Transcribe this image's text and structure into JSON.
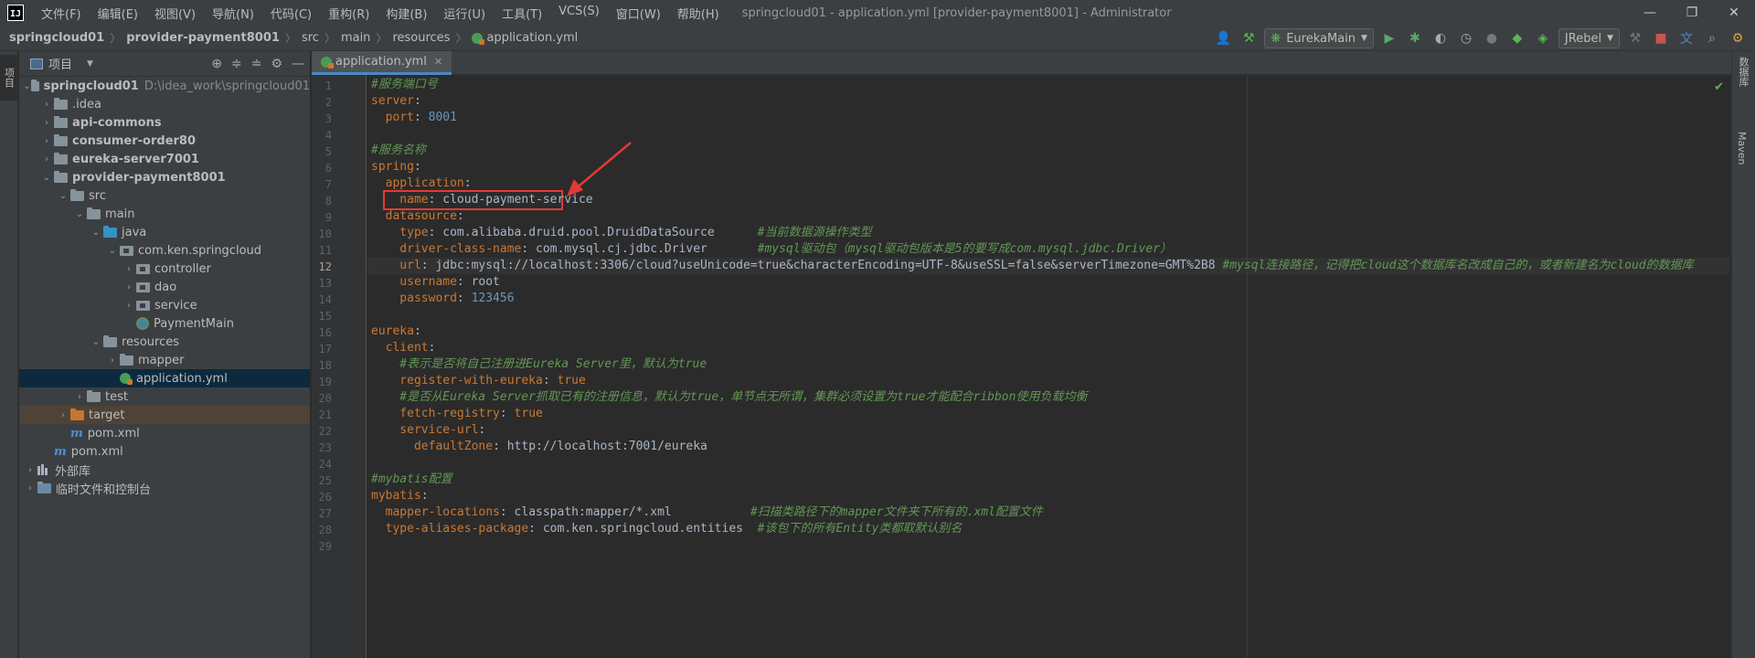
{
  "titlebar": {
    "logo": "IJ",
    "menu": [
      "文件(F)",
      "编辑(E)",
      "视图(V)",
      "导航(N)",
      "代码(C)",
      "重构(R)",
      "构建(B)",
      "运行(U)",
      "工具(T)",
      "VCS(S)",
      "窗口(W)",
      "帮助(H)"
    ],
    "title": "springcloud01 - application.yml [provider-payment8001] - Administrator",
    "buttons": [
      "minimize",
      "restore",
      "close"
    ]
  },
  "breadcrumbs": [
    "springcloud01",
    "provider-payment8001",
    "src",
    "main",
    "resources",
    "application.yml"
  ],
  "toolbar": {
    "run_config": "EurekaMain",
    "jrebel": "JRebel",
    "icons": [
      "user-icon",
      "hammer-icon",
      "run-icon",
      "debug-icon",
      "coverage-icon",
      "profile-icon",
      "stop-icon",
      "jrebel-run-icon",
      "jrebel-debug-icon",
      "translate-icon",
      "search-icon",
      "settings-icon"
    ]
  },
  "left_strip": {
    "tab_label": "项目"
  },
  "project_panel": {
    "title": "项目",
    "tree": [
      {
        "label": "springcloud01",
        "path": "D:\\idea_work\\springcloud01",
        "level": 0,
        "type": "module",
        "open": true,
        "bold": true
      },
      {
        "label": ".idea",
        "level": 1,
        "type": "folder",
        "open": false
      },
      {
        "label": "api-commons",
        "level": 1,
        "type": "module",
        "open": false,
        "bold": true
      },
      {
        "label": "consumer-order80",
        "level": 1,
        "type": "module",
        "open": false,
        "bold": true
      },
      {
        "label": "eureka-server7001",
        "level": 1,
        "type": "module",
        "open": false,
        "bold": true
      },
      {
        "label": "provider-payment8001",
        "level": 1,
        "type": "module",
        "open": true,
        "bold": true
      },
      {
        "label": "src",
        "level": 2,
        "type": "folder",
        "open": true
      },
      {
        "label": "main",
        "level": 3,
        "type": "folder",
        "open": true
      },
      {
        "label": "java",
        "level": 4,
        "type": "blue",
        "open": true
      },
      {
        "label": "com.ken.springcloud",
        "level": 5,
        "type": "pkg",
        "open": true
      },
      {
        "label": "controller",
        "level": 6,
        "type": "pkg",
        "open": false
      },
      {
        "label": "dao",
        "level": 6,
        "type": "pkg",
        "open": false
      },
      {
        "label": "service",
        "level": 6,
        "type": "pkg",
        "open": false
      },
      {
        "label": "PaymentMain",
        "level": 6,
        "type": "spring",
        "leaf": true
      },
      {
        "label": "resources",
        "level": 4,
        "type": "folder",
        "open": true
      },
      {
        "label": "mapper",
        "level": 5,
        "type": "folder",
        "open": false
      },
      {
        "label": "application.yml",
        "level": 5,
        "type": "yml",
        "leaf": true,
        "selected": true
      },
      {
        "label": "test",
        "level": 3,
        "type": "folder",
        "open": false
      },
      {
        "label": "target",
        "level": 2,
        "type": "orange",
        "open": false,
        "excluded": true
      },
      {
        "label": "pom.xml",
        "level": 2,
        "type": "maven",
        "leaf": true
      },
      {
        "label": "pom.xml",
        "level": 1,
        "type": "maven",
        "leaf": true
      },
      {
        "label": "外部库",
        "level": 0,
        "type": "lib",
        "open": false
      },
      {
        "label": "临时文件和控制台",
        "level": 0,
        "type": "scratch",
        "open": false
      }
    ]
  },
  "editor": {
    "tab_label": "application.yml",
    "current_line": 12,
    "lines": [
      [
        {
          "t": "#服务端口号",
          "c": "c"
        }
      ],
      [
        {
          "t": "server",
          "c": "k"
        },
        {
          "t": ":",
          "c": "v"
        }
      ],
      [
        {
          "t": "  port",
          "c": "k"
        },
        {
          "t": ": ",
          "c": "v"
        },
        {
          "t": "8001",
          "c": "n"
        }
      ],
      [],
      [
        {
          "t": "#服务名称",
          "c": "c"
        }
      ],
      [
        {
          "t": "spring",
          "c": "k"
        },
        {
          "t": ":",
          "c": "v"
        }
      ],
      [
        {
          "t": "  application",
          "c": "k"
        },
        {
          "t": ":",
          "c": "v"
        }
      ],
      [
        {
          "t": "    name",
          "c": "k"
        },
        {
          "t": ": cloud-payment-service",
          "c": "v"
        }
      ],
      [
        {
          "t": "  datasource",
          "c": "k"
        },
        {
          "t": ":",
          "c": "v"
        }
      ],
      [
        {
          "t": "    type",
          "c": "k"
        },
        {
          "t": ": com.alibaba.druid.pool.DruidDataSource      ",
          "c": "v"
        },
        {
          "t": "#当前数据源操作类型",
          "c": "c"
        }
      ],
      [
        {
          "t": "    driver-class-name",
          "c": "k"
        },
        {
          "t": ": com.mysql.cj.jdbc.Driver       ",
          "c": "v"
        },
        {
          "t": "#mysql驱动包（mysql驱动包版本是5的要写成com.mysql.jdbc.Driver）",
          "c": "c"
        }
      ],
      [
        {
          "t": "    url",
          "c": "k"
        },
        {
          "t": ": jdbc:mysql://localhost:3306/cloud?useUnicode=true&characterEncoding=UTF-8&useSSL=false&serverTimezone=GMT%2B8 ",
          "c": "v"
        },
        {
          "t": "#mysql连接路径，记得把cloud这个数据库名改成自己的，或者新建名为cloud的数据库",
          "c": "c"
        }
      ],
      [
        {
          "t": "    username",
          "c": "k"
        },
        {
          "t": ": root",
          "c": "v"
        }
      ],
      [
        {
          "t": "    password",
          "c": "k"
        },
        {
          "t": ": ",
          "c": "v"
        },
        {
          "t": "123456",
          "c": "n"
        }
      ],
      [],
      [
        {
          "t": "eureka",
          "c": "k"
        },
        {
          "t": ":",
          "c": "v"
        }
      ],
      [
        {
          "t": "  client",
          "c": "k"
        },
        {
          "t": ":",
          "c": "v"
        }
      ],
      [
        {
          "t": "    #表示是否将自己注册进Eureka Server里，默认为true",
          "c": "c"
        }
      ],
      [
        {
          "t": "    register-with-eureka",
          "c": "k"
        },
        {
          "t": ": ",
          "c": "v"
        },
        {
          "t": "true",
          "c": "k"
        }
      ],
      [
        {
          "t": "    #是否从Eureka Server抓取已有的注册信息，默认为true，单节点无所谓，集群必须设置为true才能配合ribbon使用负载均衡",
          "c": "c"
        }
      ],
      [
        {
          "t": "    fetch-registry",
          "c": "k"
        },
        {
          "t": ": ",
          "c": "v"
        },
        {
          "t": "true",
          "c": "k"
        }
      ],
      [
        {
          "t": "    service-url",
          "c": "k"
        },
        {
          "t": ":",
          "c": "v"
        }
      ],
      [
        {
          "t": "      defaultZone",
          "c": "k"
        },
        {
          "t": ": http://localhost:7001/eureka",
          "c": "v"
        }
      ],
      [],
      [
        {
          "t": "#mybatis配置",
          "c": "c"
        }
      ],
      [
        {
          "t": "mybatis",
          "c": "k"
        },
        {
          "t": ":",
          "c": "v"
        }
      ],
      [
        {
          "t": "  mapper-locations",
          "c": "k"
        },
        {
          "t": ": classpath:mapper/*.xml           ",
          "c": "v"
        },
        {
          "t": "#扫描类路径下的mapper文件夹下所有的.xml配置文件",
          "c": "c"
        }
      ],
      [
        {
          "t": "  type-aliases-package",
          "c": "k"
        },
        {
          "t": ": com.ken.springcloud.entities  ",
          "c": "v"
        },
        {
          "t": "#该包下的所有Entity类都取默认别名",
          "c": "c"
        }
      ],
      []
    ]
  },
  "right_strip": {
    "tabs": [
      "数据库",
      "Maven"
    ]
  },
  "colors": {
    "accent": "#4a88c7",
    "annotation": "#e53935",
    "check": "#5fb35a"
  }
}
